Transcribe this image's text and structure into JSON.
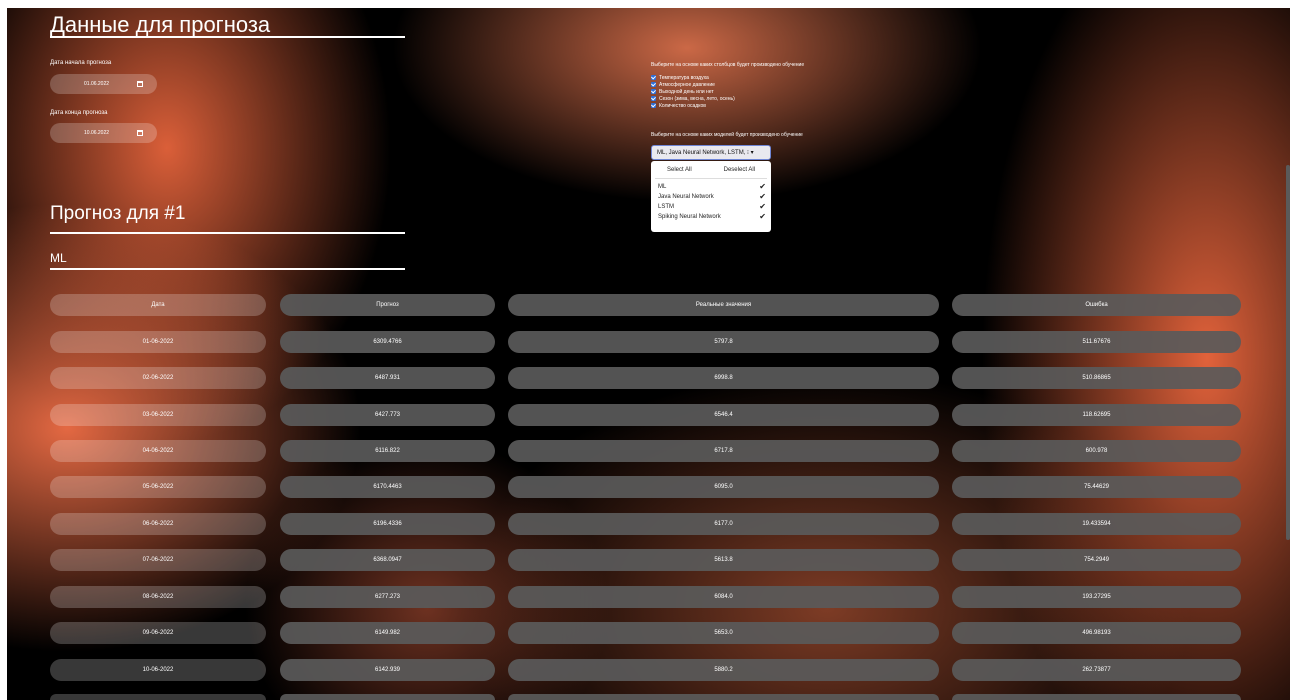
{
  "form": {
    "title": "Данные для прогноза",
    "start_label": "Дата начала прогноза",
    "start_value": "01.06.2022",
    "end_label": "Дата конца прогноза",
    "end_value": "10.06.2022"
  },
  "features": {
    "hint": "Выберите на основе каких столбцов будет производено обучение",
    "items": [
      "Температура воздуха",
      "Атмосферное давление",
      "Выходной день или нет",
      "Сезон (зима, весна, лето, осень)",
      "Количество осадков"
    ]
  },
  "models": {
    "hint": "Выберите на основе каких моделей будет производено обучение",
    "selected": "ML, Java Neural Network, LSTM, ⁝ ▾",
    "select_all": "Select All",
    "deselect_all": "Deselect All",
    "options": [
      "ML",
      "Java Neural Network",
      "LSTM",
      "Spiking Neural Network"
    ]
  },
  "forecast": {
    "title": "Прогноз для #1",
    "model": "ML"
  },
  "table": {
    "headers": [
      "Дата",
      "Прогноз",
      "Реальные значения",
      "Ошибка"
    ],
    "rows": [
      [
        "01-06-2022",
        "6309.4766",
        "5797.8",
        "511.67676"
      ],
      [
        "02-06-2022",
        "6487.931",
        "6998.8",
        "510.86865"
      ],
      [
        "03-06-2022",
        "6427.773",
        "6546.4",
        "118.62695"
      ],
      [
        "04-06-2022",
        "6116.822",
        "6717.8",
        "600.978"
      ],
      [
        "05-06-2022",
        "6170.4463",
        "6095.0",
        "75.44629"
      ],
      [
        "06-06-2022",
        "6196.4336",
        "6177.0",
        "19.433594"
      ],
      [
        "07-06-2022",
        "6368.0947",
        "5613.8",
        "754.2949"
      ],
      [
        "08-06-2022",
        "6277.273",
        "6084.0",
        "193.27295"
      ],
      [
        "09-06-2022",
        "6149.982",
        "5653.0",
        "496.98193"
      ],
      [
        "10-06-2022",
        "6142.939",
        "5880.2",
        "262.73877"
      ]
    ]
  }
}
